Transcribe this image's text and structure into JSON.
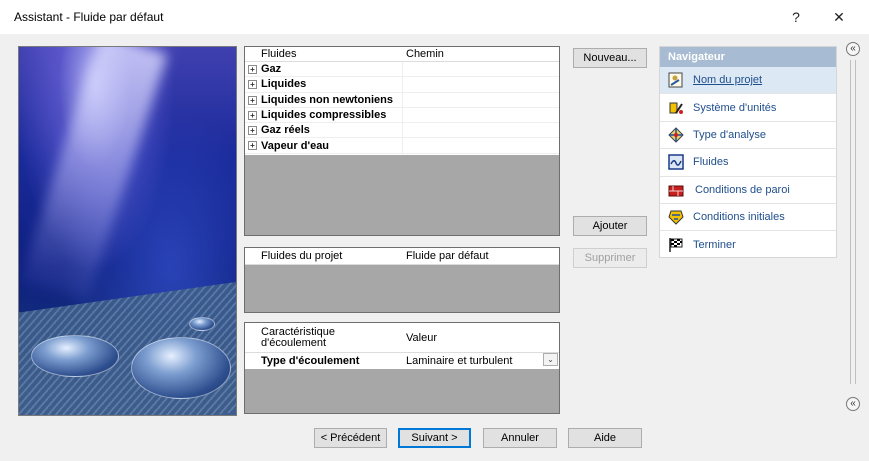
{
  "window": {
    "title": "Assistant - Fluide par défaut",
    "help_label": "?",
    "close_label": "✕"
  },
  "fluids": {
    "header": {
      "col1": "Fluides",
      "col2": "Chemin"
    },
    "rows": [
      "Gaz",
      "Liquides",
      "Liquides non newtoniens",
      "Liquides compressibles",
      "Gaz réels",
      "Vapeur d'eau"
    ],
    "expander_label": "+"
  },
  "project_fluids": {
    "header": {
      "col1": "Fluides du projet",
      "col2": "Fluide par défaut"
    }
  },
  "flow": {
    "header": {
      "col1": "Caractéristique d'écoulement",
      "col2": "Valeur"
    },
    "row": {
      "label": "Type d'écoulement",
      "value": "Laminaire et turbulent",
      "arrow": "⌄"
    }
  },
  "buttons": {
    "new": "Nouveau...",
    "add": "Ajouter",
    "remove": "Supprimer",
    "prev": "< Précédent",
    "next": "Suivant >",
    "cancel": "Annuler",
    "help": "Aide"
  },
  "navigator": {
    "title": "Navigateur",
    "items": [
      {
        "label": "Nom du projet",
        "icon": "project-name-icon",
        "active": true
      },
      {
        "label": "Système d'unités",
        "icon": "unit-system-icon"
      },
      {
        "label": "Type d'analyse",
        "icon": "analysis-type-icon"
      },
      {
        "label": "Fluides",
        "icon": "fluids-icon"
      },
      {
        "label": "Conditions de paroi",
        "icon": "wall-conditions-icon"
      },
      {
        "label": "Conditions initiales",
        "icon": "initial-conditions-icon"
      },
      {
        "label": "Terminer",
        "icon": "finish-flag-icon"
      }
    ]
  },
  "collapse": {
    "top": "«",
    "bottom": "«"
  },
  "colors": {
    "accent": "#0078d7",
    "nav_header": "#a7bbd2",
    "nav_text": "#1f4e8c",
    "pane_gray": "#a7a7a7"
  }
}
